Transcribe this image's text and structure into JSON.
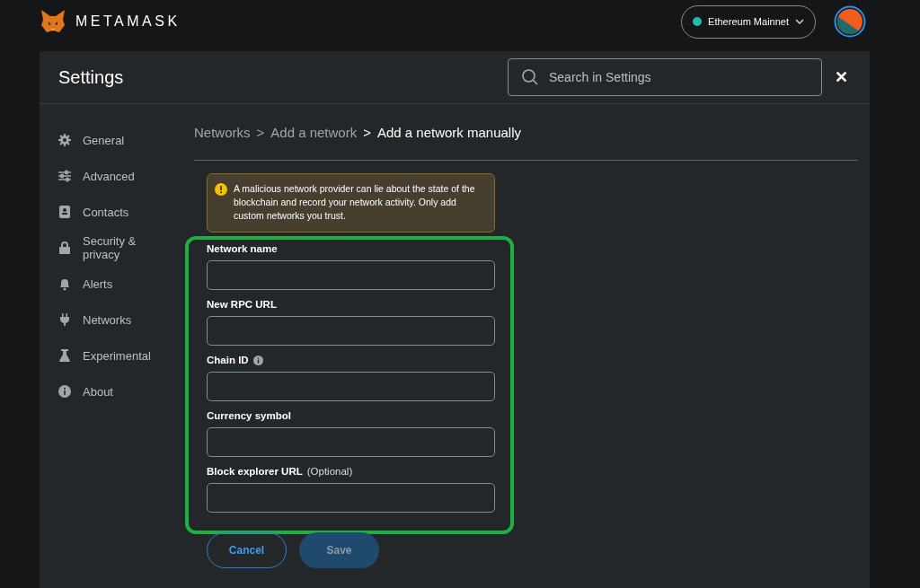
{
  "header": {
    "brand": "METAMASK",
    "network": {
      "label": "Ethereum Mainnet",
      "color": "#29b6af"
    }
  },
  "settings": {
    "title": "Settings",
    "search": {
      "placeholder": "Search in Settings"
    },
    "close": "✕"
  },
  "sidebar": {
    "items": [
      {
        "label": "General",
        "selected": false
      },
      {
        "label": "Advanced",
        "selected": false
      },
      {
        "label": "Contacts",
        "selected": false
      },
      {
        "label": "Security & privacy",
        "selected": false
      },
      {
        "label": "Alerts",
        "selected": false
      },
      {
        "label": "Networks",
        "selected": false
      },
      {
        "label": "Experimental",
        "selected": false
      },
      {
        "label": "About",
        "selected": false
      }
    ]
  },
  "breadcrumb": [
    {
      "label": "Networks",
      "current": false
    },
    {
      "label": "Add a network",
      "current": false
    },
    {
      "label": "Add a network manually",
      "current": true
    }
  ],
  "breadcrumb_separators": [
    ">",
    ">"
  ],
  "warning": "A malicious network provider can lie about the state of the blockchain and record your network activity. Only add custom networks you trust.",
  "form": {
    "fields": [
      {
        "label": "Network name",
        "info": false
      },
      {
        "label": "New RPC URL",
        "info": false
      },
      {
        "label": "Chain ID",
        "info": true
      },
      {
        "label": "Currency symbol",
        "info": false
      },
      {
        "label": "Block explorer URL",
        "hint": "(Optional)",
        "info": false
      }
    ]
  },
  "buttons": [
    {
      "label": "Cancel",
      "kind": "secondary",
      "disabled": false
    },
    {
      "label": "Save",
      "kind": "primary",
      "disabled": true
    }
  ]
}
